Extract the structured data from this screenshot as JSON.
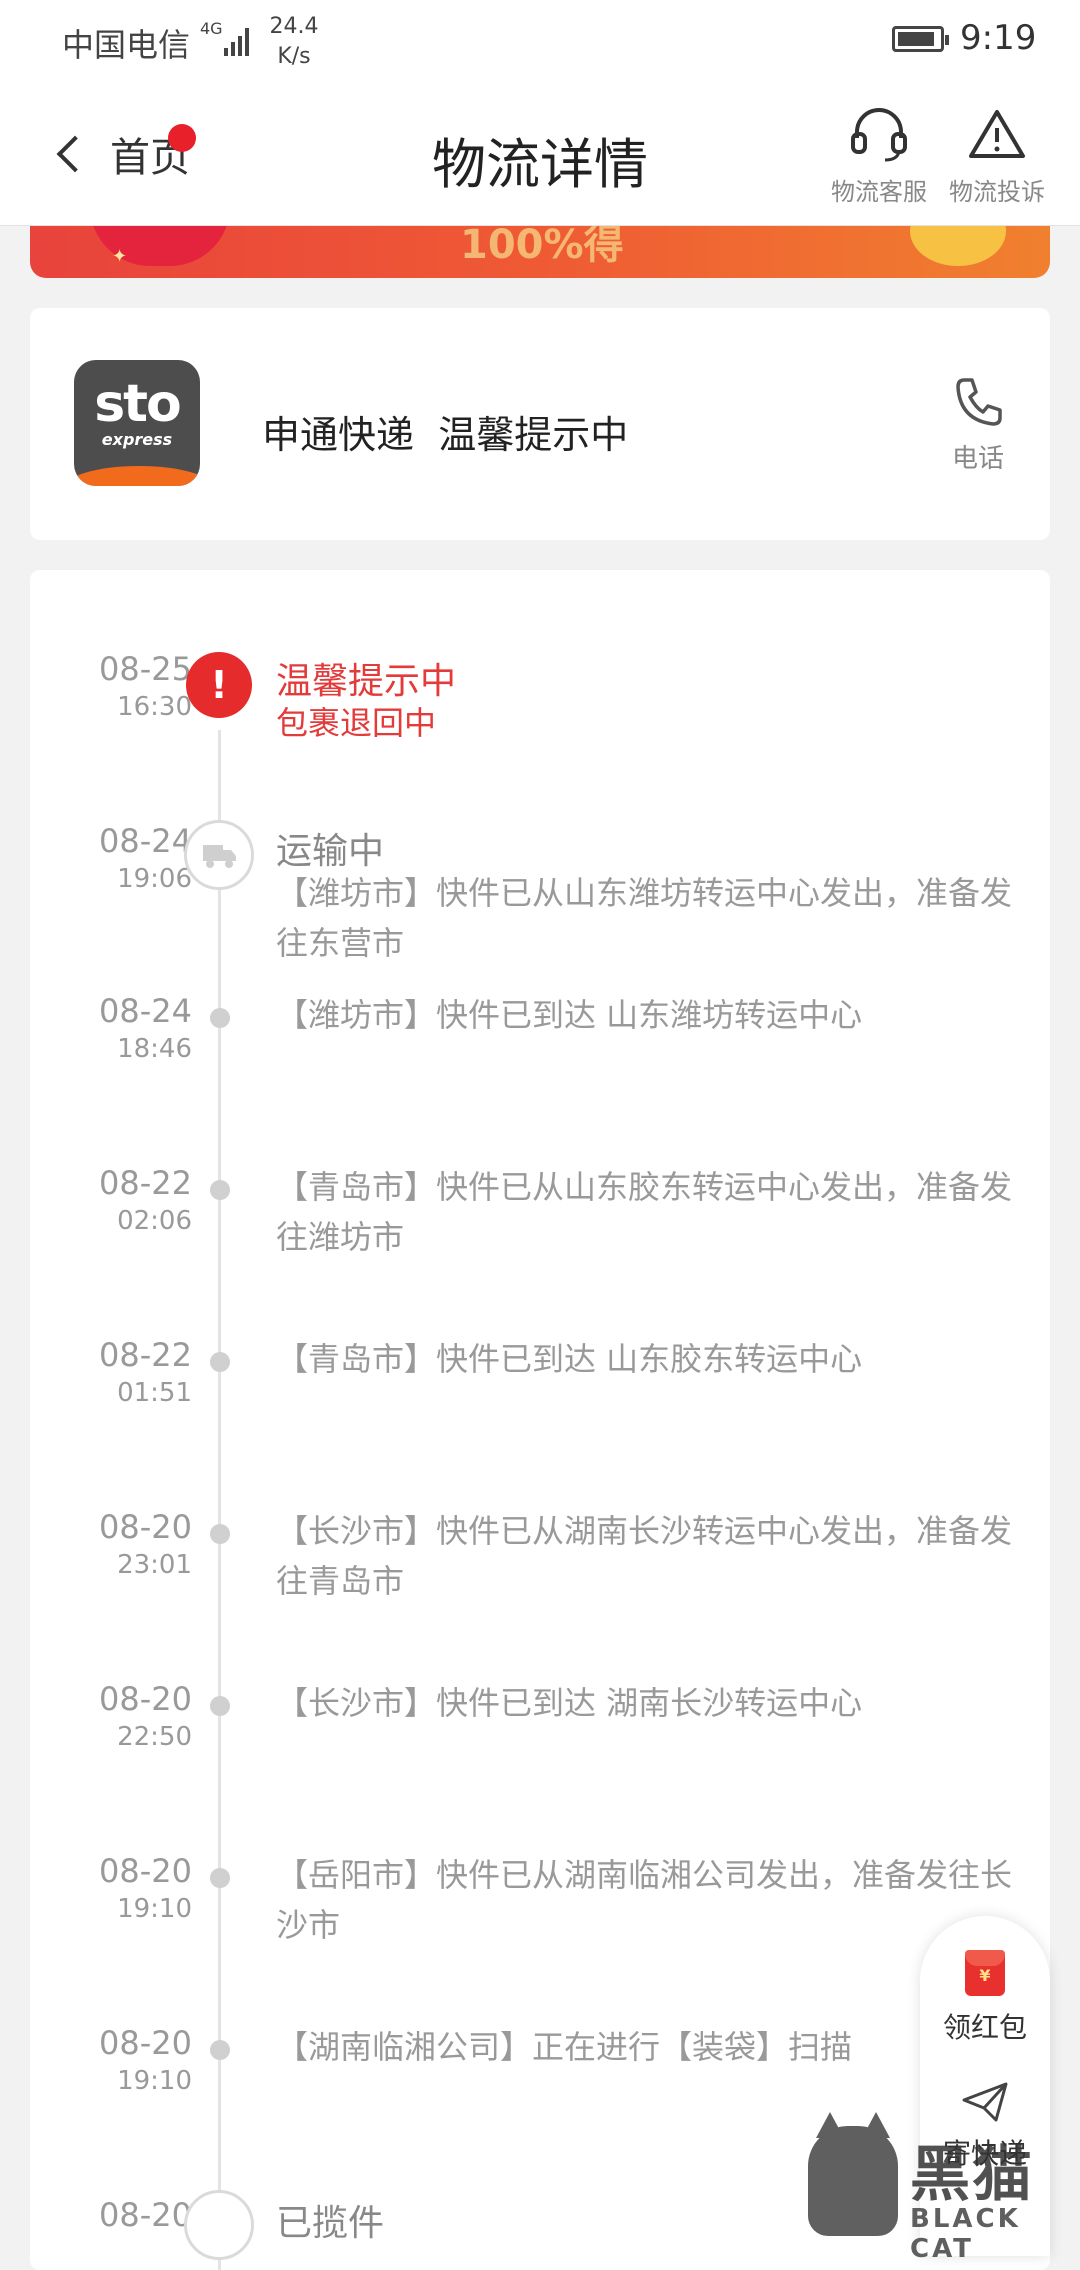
{
  "status_bar": {
    "carrier": "中国电信",
    "network": "4G",
    "speed_value": "24.4",
    "speed_unit": "K/s",
    "time": "9:19"
  },
  "nav": {
    "back_label": "首页",
    "title": "物流详情",
    "service_label": "物流客服",
    "complaint_label": "物流投诉"
  },
  "banner": {
    "partial_text": "100%得"
  },
  "carrier_card": {
    "logo_text": "sto",
    "logo_subtext": "express",
    "name": "申通快递",
    "status": "温馨提示中",
    "phone_label": "电话"
  },
  "timeline": [
    {
      "date": "08-25",
      "time": "16:30",
      "title": "温馨提示中",
      "text": "包裹退回中",
      "marker": "alert"
    },
    {
      "date": "08-24",
      "time": "19:06",
      "title": "运输中",
      "text": "【潍坊市】快件已从山东潍坊转运中心发出，准备发往东营市",
      "marker": "truck"
    },
    {
      "date": "08-24",
      "time": "18:46",
      "text": "【潍坊市】快件已到达 山东潍坊转运中心",
      "marker": "dot"
    },
    {
      "date": "08-22",
      "time": "02:06",
      "text": "【青岛市】快件已从山东胶东转运中心发出，准备发往潍坊市",
      "marker": "dot"
    },
    {
      "date": "08-22",
      "time": "01:51",
      "text": "【青岛市】快件已到达 山东胶东转运中心",
      "marker": "dot"
    },
    {
      "date": "08-20",
      "time": "23:01",
      "text": "【长沙市】快件已从湖南长沙转运中心发出，准备发往青岛市",
      "marker": "dot"
    },
    {
      "date": "08-20",
      "time": "22:50",
      "text": "【长沙市】快件已到达 湖南长沙转运中心",
      "marker": "dot"
    },
    {
      "date": "08-20",
      "time": "19:10",
      "text": "【岳阳市】快件已从湖南临湘公司发出，准备发往长沙市",
      "marker": "dot"
    },
    {
      "date": "08-20",
      "time": "19:10",
      "text": "【湖南临湘公司】正在进行【装袋】扫描",
      "marker": "dot"
    },
    {
      "date": "08-20",
      "title": "已揽件",
      "marker": "ring"
    }
  ],
  "floating_panel": {
    "red_packet_label": "领红包",
    "red_packet_symbol": "¥",
    "send_label": "寄快递"
  },
  "watermark": {
    "cn": "黑猫",
    "en": "BLACK CAT"
  },
  "colors": {
    "accent_red": "#e52b2b",
    "banner_orange": "#f0802f",
    "logo_orange": "#f26b1d"
  }
}
